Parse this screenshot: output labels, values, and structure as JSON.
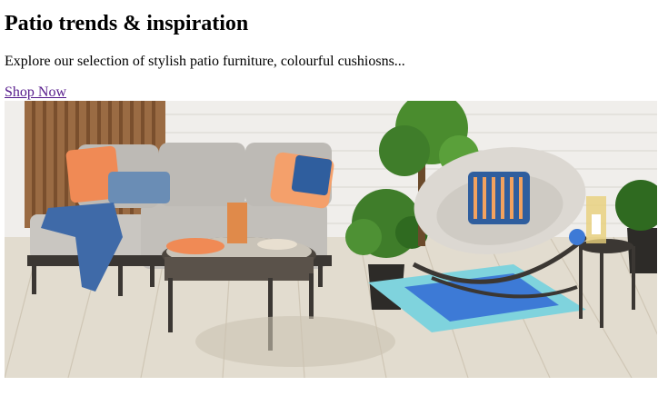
{
  "banner": {
    "title": "Patio trends & inspiration",
    "description": "Explore our selection of stylish patio furniture, colourful cushiosns...",
    "cta_label": "Shop Now"
  },
  "hero_image": {
    "subject": "patio scene",
    "colors": {
      "link": "#551a8b",
      "wall": "#f0eeeb",
      "deck": "#e2dccf",
      "cushion_grey": "#c9c6c1",
      "frame_dark": "#3b3733",
      "pillow_orange": "#f08a55",
      "pillow_blue": "#2f5e9e",
      "rug_blue": "#3d7ad6",
      "rug_teal": "#7fd3dd",
      "plant_green": "#3f7d2a"
    }
  }
}
